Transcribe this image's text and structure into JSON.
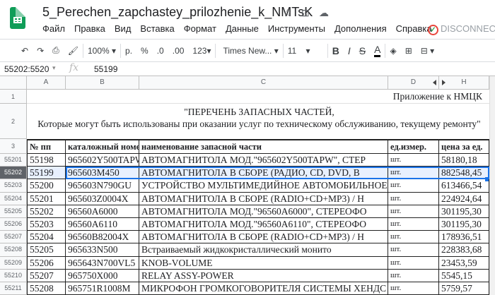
{
  "doc": {
    "title": "5_Perechen_zapchastey_prilozhenie_k_NMTsK",
    "icons": [
      "star-icon",
      "move-to-folder-icon",
      "cloud-status-icon"
    ]
  },
  "menu": [
    "Файл",
    "Правка",
    "Вид",
    "Вставка",
    "Формат",
    "Данные",
    "Инструменты",
    "Дополнения",
    "Справка"
  ],
  "status": "DISCONNECTED",
  "toolbar": {
    "zoom": "100%",
    "currency": "р.",
    "percent": "%",
    "dec_less": ".0",
    "dec_more": ".00",
    "format": "123",
    "font": "Times New...",
    "size": "11",
    "bold": "B",
    "italic": "I",
    "strike": "S",
    "text_color": "A"
  },
  "formula": {
    "namebox": "55202:5520",
    "fx": "fx",
    "value": "55199"
  },
  "columns": [
    "A",
    "B",
    "C",
    "D",
    "H"
  ],
  "row_headers_top": [
    "1",
    "2",
    "3"
  ],
  "row1_text": "Приложение к НМЦК",
  "row2_line1": "\"ПЕРЕЧЕНЬ ЗАПАСНЫХ ЧАСТЕЙ,",
  "row2_line2": "Которые могут быть использованы при оказании услуг по техническому обслуживанию, текущему ремонту\"",
  "table_headers": [
    "№ пп",
    "каталожный номе",
    "наименование запасной части",
    "ед.измер.",
    "цена за ед."
  ],
  "rows": [
    {
      "rn": "55201",
      "n": "55198",
      "cat": "965602Y500TAPW",
      "name": "АВТОМАГНИТОЛА МОД.\"965602Y500TAPW\", СТЕР",
      "unit": "шт.",
      "price": "58180,18"
    },
    {
      "rn": "55202",
      "n": "55199",
      "cat": "965603M450",
      "name": "АВТОМАГНИТОЛА В СБОРЕ (РАДИО, CD, DVD, В",
      "unit": "шт.",
      "price": "882548,45"
    },
    {
      "rn": "55203",
      "n": "55200",
      "cat": "965603N790GU",
      "name": "УСТРОЙСТВО МУЛЬТИМЕДИЙНОЕ АВТОМОБИЛЬНОЕ",
      "unit": "шт.",
      "price": "613466,54"
    },
    {
      "rn": "55204",
      "n": "55201",
      "cat": "965603Z0004X",
      "name": "АВТОМАГНИТОЛА В СБОРЕ (RADIO+CD+MP3) / Н",
      "unit": "шт.",
      "price": "224924,64"
    },
    {
      "rn": "55205",
      "n": "55202",
      "cat": "96560A6000",
      "name": "АВТОМАГНИТОЛА МОД.\"96560A6000\", СТЕРЕОФО",
      "unit": "шт.",
      "price": "301195,30"
    },
    {
      "rn": "55206",
      "n": "55203",
      "cat": "96560A6110",
      "name": "АВТОМАГНИТОЛА МОД.\"96560A6110\", СТЕРЕОФО",
      "unit": "шт.",
      "price": "301195,30"
    },
    {
      "rn": "55207",
      "n": "55204",
      "cat": "96560B82004X",
      "name": "АВТОМАГНИТОЛА В СБОРЕ (RADIO+CD+MP3) / Н",
      "unit": "шт.",
      "price": "178936,51"
    },
    {
      "rn": "55208",
      "n": "55205",
      "cat": "965633N500",
      "name": "Встраиваемый жидкокристаллический монито",
      "unit": "шт.",
      "price": "228383,68"
    },
    {
      "rn": "55209",
      "n": "55206",
      "cat": "965643N700VL5",
      "name": "KNOB-VOLUME",
      "unit": "шт.",
      "price": "23453,59"
    },
    {
      "rn": "55210",
      "n": "55207",
      "cat": "965750X000",
      "name": "RELAY ASSY-POWER",
      "unit": "шт.",
      "price": "5545,15"
    },
    {
      "rn": "55211",
      "n": "55208",
      "cat": "965751R1008M",
      "name": "МИКРОФОН ГРОМКОГОВОРИТЕЛЯ СИСТЕМЫ ХЕНДС",
      "unit": "шт.",
      "price": "5759,57"
    }
  ],
  "selected_row": "55202"
}
